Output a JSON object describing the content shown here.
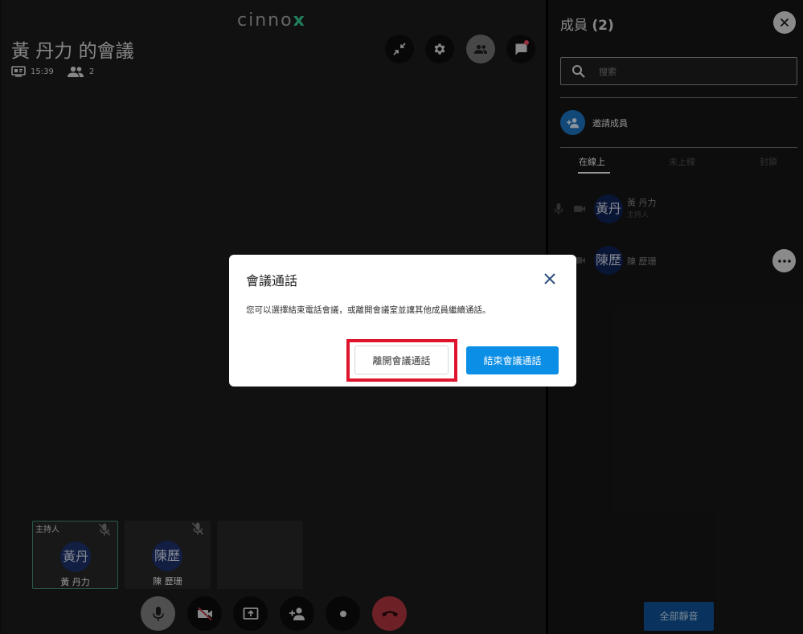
{
  "meeting": {
    "logo_prefix": "cinno",
    "logo_x": "x",
    "title": "黃 丹力 的會議",
    "duration": "15:39",
    "participant_count": "2"
  },
  "tiles": [
    {
      "tag": "主持人",
      "avatar": "黃丹",
      "name": "黃 丹力"
    },
    {
      "tag": "",
      "avatar": "陳歷",
      "name": "陳 歷珊"
    }
  ],
  "sidebar": {
    "title": "成員",
    "count": "(2)",
    "search_placeholder": "搜索",
    "invite_label": "邀請成員",
    "tabs": [
      "在線上",
      "未上線",
      "封鎖"
    ],
    "members": [
      {
        "avatar": "黃丹",
        "name": "黃 丹力",
        "role": "主持人"
      },
      {
        "avatar": "陳歷",
        "name": "陳 歷珊",
        "role": ""
      }
    ],
    "mute_all_label": "全部靜音"
  },
  "dialog": {
    "title": "會議通話",
    "message": "您可以選擇結束電話會議，或離開會議室並讓其他成員繼續通話。",
    "leave_label": "離開會議通話",
    "end_label": "結束會議通話"
  },
  "colors": {
    "accent_blue": "#0a8ee6",
    "hangup_red": "#a8343c",
    "highlight_red": "#e0152d",
    "host_border": "#3d8d6a"
  }
}
